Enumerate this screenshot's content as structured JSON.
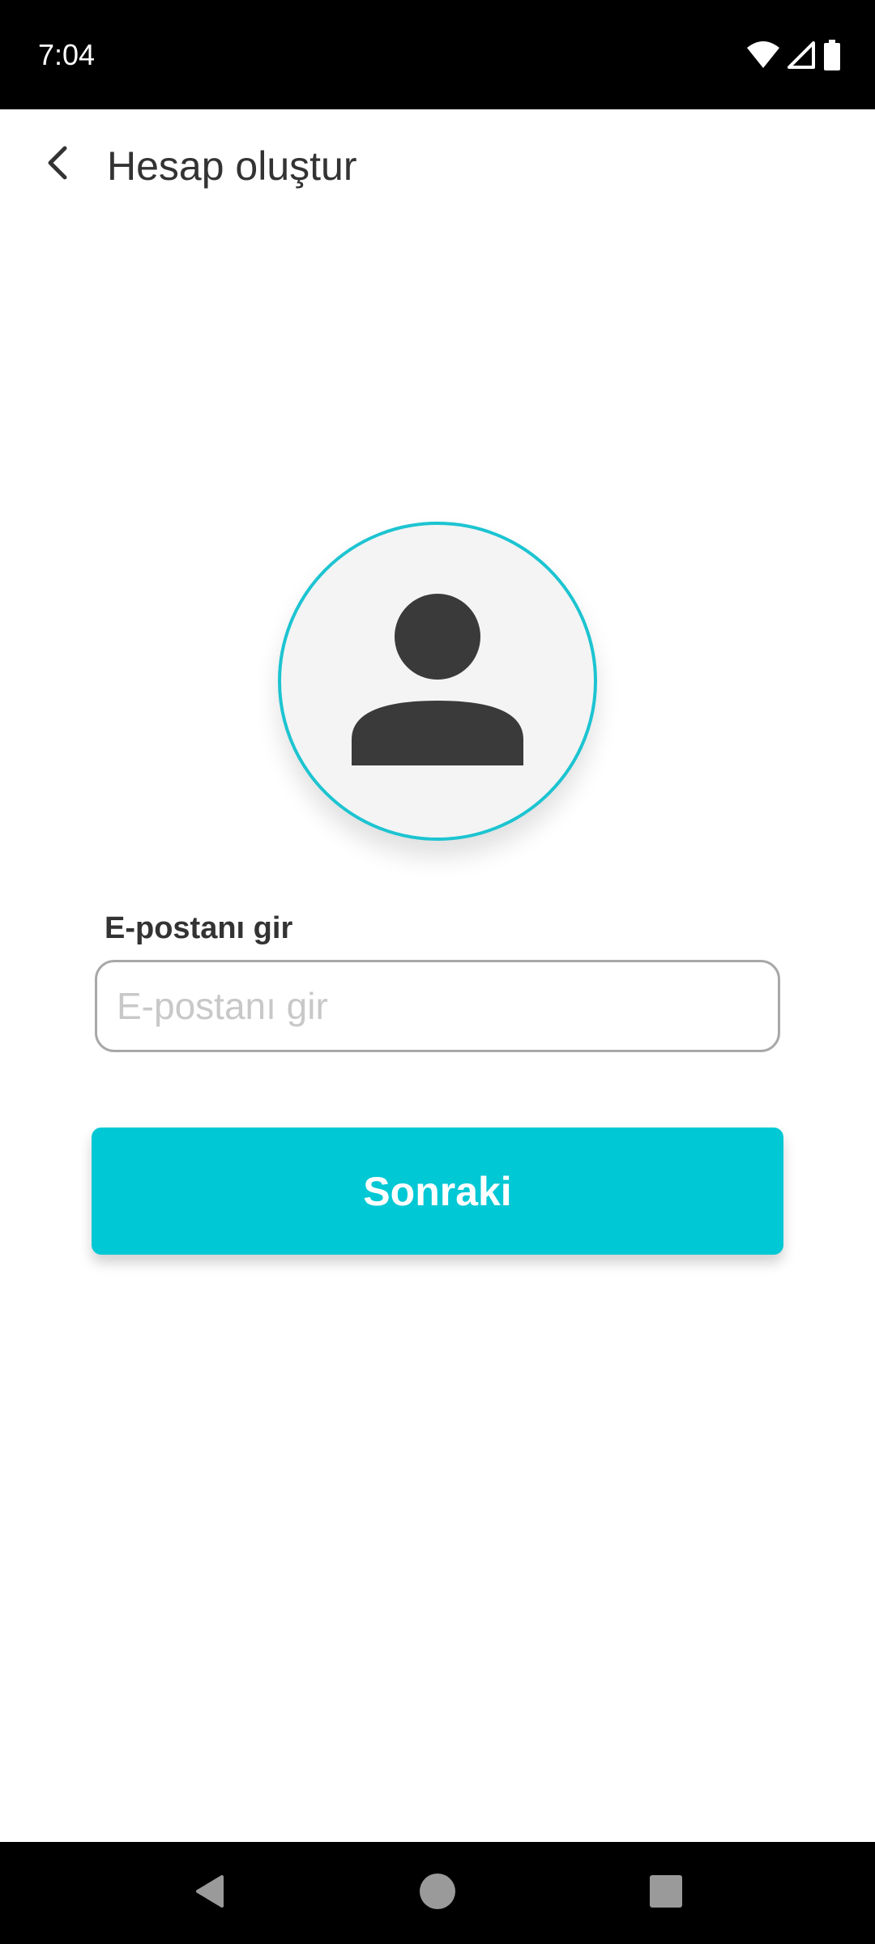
{
  "status_bar": {
    "time": "7:04",
    "icons": [
      "wifi-icon",
      "cellular-signal-icon",
      "battery-icon"
    ]
  },
  "app_bar": {
    "back_icon": "chevron-left-icon",
    "title": "Hesap oluştur"
  },
  "avatar": {
    "icon": "person-icon",
    "border_color": "#1cc4d1"
  },
  "email": {
    "label": "E-postanı gir",
    "placeholder": "E-postanı gir",
    "value": ""
  },
  "next_button": {
    "label": "Sonraki",
    "color": "#00c8d4"
  },
  "nav_bar": {
    "icons": [
      "nav-back-icon",
      "nav-home-icon",
      "nav-recents-icon"
    ]
  }
}
